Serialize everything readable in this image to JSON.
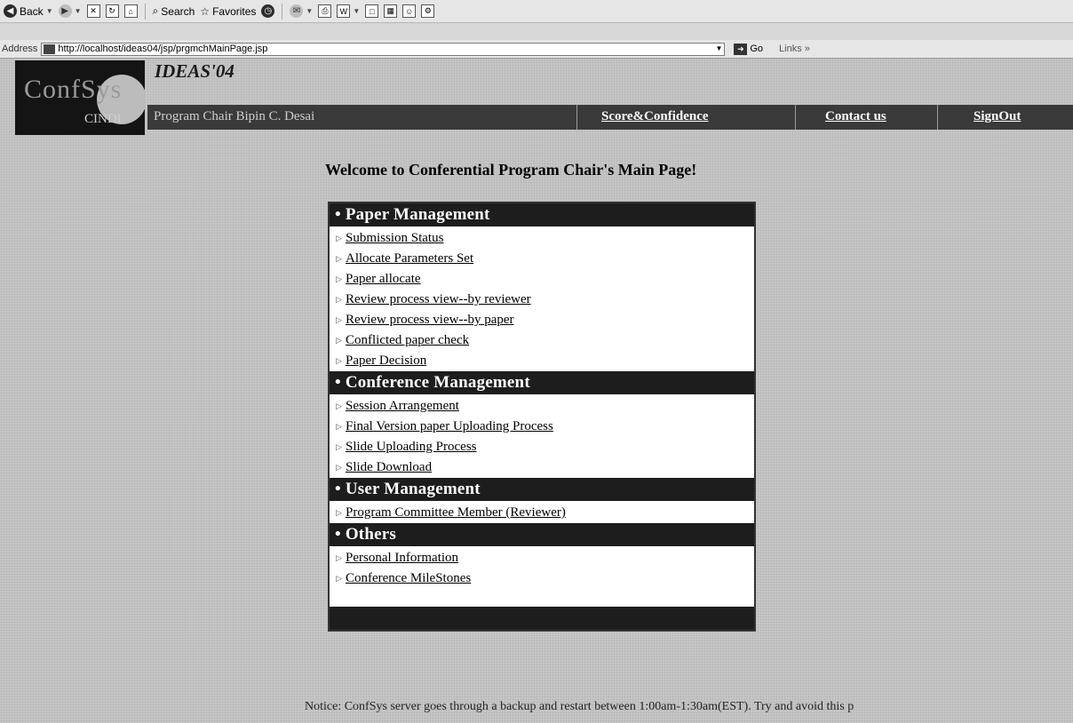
{
  "browser": {
    "toolbar": {
      "back_label": "Back",
      "search_label": "Search",
      "favorites_label": "Favorites"
    },
    "address": {
      "label": "Address",
      "url": "http://localhost/ideas04/jsp/prgmchMainPage.jsp",
      "go_label": "Go",
      "links_label": "Links"
    }
  },
  "header": {
    "logo_text": "ConfSys",
    "logo_subtext": "CINDI",
    "conference_title": "IDEAS'04",
    "user_label": "Program Chair Bipin C. Desai",
    "nav_links": [
      "Score&Confidence",
      "Contact us",
      "SignOut"
    ]
  },
  "main": {
    "welcome": "Welcome to Conferential Program Chair's Main Page!",
    "sections": [
      {
        "title": "Paper Management",
        "items": [
          "Submission Status",
          "Allocate Parameters Set",
          "Paper allocate",
          "Review process view--by reviewer",
          "Review process view--by paper",
          "Conflicted paper check",
          "Paper Decision"
        ]
      },
      {
        "title": "Conference Management",
        "items": [
          "Session Arrangement",
          "Final Version paper Uploading Process",
          "Slide Uploading Process",
          "Slide Download"
        ]
      },
      {
        "title": "User Management",
        "items": [
          "Program Committee Member (Reviewer)"
        ]
      },
      {
        "title": "Others",
        "items": [
          "Personal Information",
          "Conference MileStones"
        ]
      }
    ],
    "notice": "Notice: ConfSys server goes through a backup and restart between 1:00am-1:30am(EST). Try and avoid this p"
  }
}
